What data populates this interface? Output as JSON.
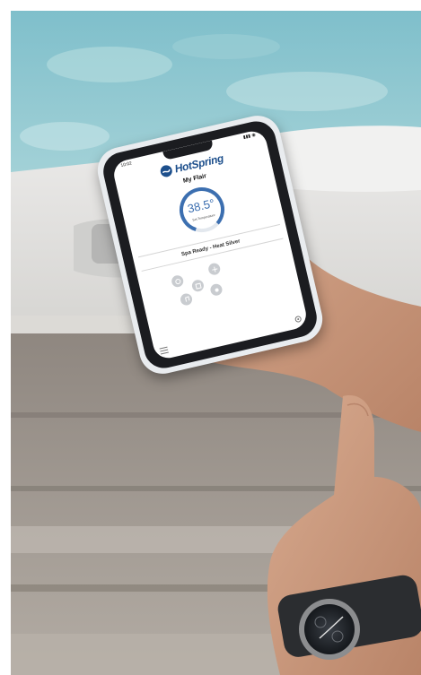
{
  "scene": {
    "description_colors": {
      "pool_water": "#8fc6cf",
      "spa_shell": "#e4e4e2",
      "cabinet": "#a39a91",
      "skin": "#c99b80",
      "accent": "#3c6fb0"
    }
  },
  "app": {
    "status_time": "10:02",
    "status_icons": "▮▮▮ ◉",
    "brand_name": "HotSpring",
    "spa_name": "My Flair",
    "temperature_value": "38.5°",
    "temperature_unit_mark": "|",
    "temperature_label": "Set Temperature",
    "spa_status": "Spa Ready - Heat Silver",
    "controls": [
      {
        "name": "jets-icon"
      },
      {
        "name": "lights-icon"
      },
      {
        "name": "clean-icon"
      },
      {
        "name": "music-icon"
      },
      {
        "name": "settings-icon"
      }
    ]
  }
}
